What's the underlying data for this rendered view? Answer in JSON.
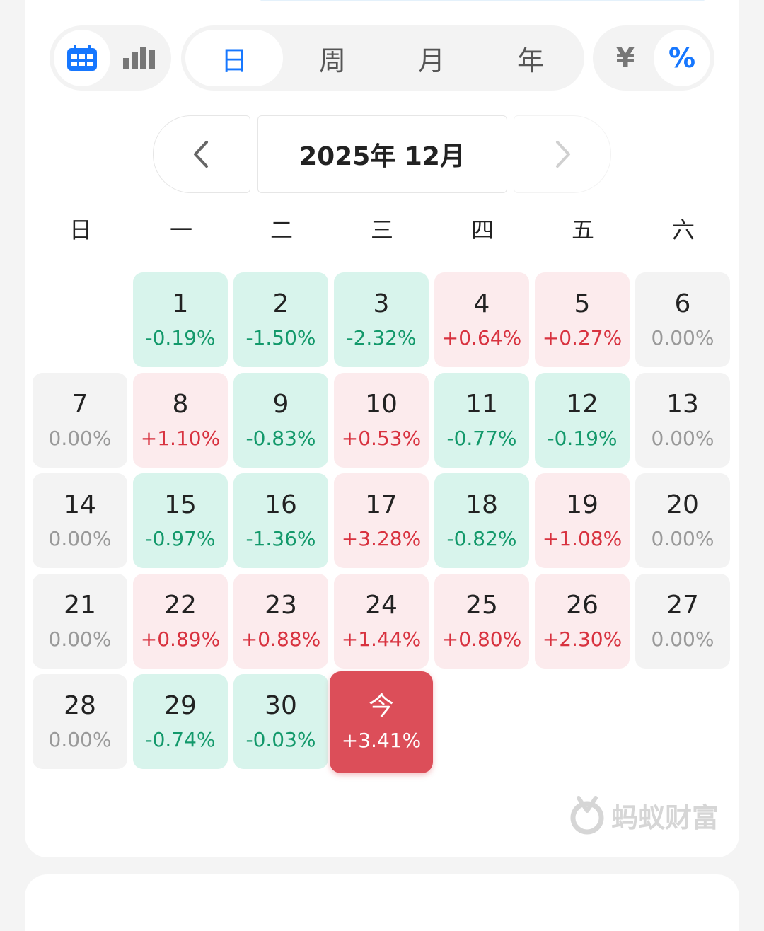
{
  "toolbar": {
    "view_icons": [
      "calendar-icon",
      "bar-chart-icon"
    ],
    "periods": [
      "日",
      "周",
      "月",
      "年"
    ],
    "active_period": "日",
    "units": [
      "¥",
      "%"
    ],
    "active_unit": "%",
    "accent_color": "#1677ff"
  },
  "month_nav": {
    "prev_icon": "chevron-left-icon",
    "title": "2025年 12月",
    "next_icon": "chevron-right-icon"
  },
  "weekdays": [
    "日",
    "一",
    "二",
    "三",
    "四",
    "五",
    "六"
  ],
  "calendar": {
    "colors": {
      "up": "#d8323f",
      "down": "#13996b",
      "today_bg": "#dc4e59"
    },
    "days": [
      {
        "day": "1",
        "pct": "-0.19%",
        "kind": "down",
        "col": 1,
        "row": 0
      },
      {
        "day": "2",
        "pct": "-1.50%",
        "kind": "down",
        "col": 2,
        "row": 0
      },
      {
        "day": "3",
        "pct": "-2.32%",
        "kind": "down",
        "col": 3,
        "row": 0
      },
      {
        "day": "4",
        "pct": "+0.64%",
        "kind": "up",
        "col": 4,
        "row": 0
      },
      {
        "day": "5",
        "pct": "+0.27%",
        "kind": "up",
        "col": 5,
        "row": 0
      },
      {
        "day": "6",
        "pct": "0.00%",
        "kind": "neutral",
        "col": 6,
        "row": 0
      },
      {
        "day": "7",
        "pct": "0.00%",
        "kind": "neutral",
        "col": 0,
        "row": 1
      },
      {
        "day": "8",
        "pct": "+1.10%",
        "kind": "up",
        "col": 1,
        "row": 1
      },
      {
        "day": "9",
        "pct": "-0.83%",
        "kind": "down",
        "col": 2,
        "row": 1
      },
      {
        "day": "10",
        "pct": "+0.53%",
        "kind": "up",
        "col": 3,
        "row": 1
      },
      {
        "day": "11",
        "pct": "-0.77%",
        "kind": "down",
        "col": 4,
        "row": 1
      },
      {
        "day": "12",
        "pct": "-0.19%",
        "kind": "down",
        "col": 5,
        "row": 1
      },
      {
        "day": "13",
        "pct": "0.00%",
        "kind": "neutral",
        "col": 6,
        "row": 1
      },
      {
        "day": "14",
        "pct": "0.00%",
        "kind": "neutral",
        "col": 0,
        "row": 2
      },
      {
        "day": "15",
        "pct": "-0.97%",
        "kind": "down",
        "col": 1,
        "row": 2
      },
      {
        "day": "16",
        "pct": "-1.36%",
        "kind": "down",
        "col": 2,
        "row": 2
      },
      {
        "day": "17",
        "pct": "+3.28%",
        "kind": "up",
        "col": 3,
        "row": 2
      },
      {
        "day": "18",
        "pct": "-0.82%",
        "kind": "down",
        "col": 4,
        "row": 2
      },
      {
        "day": "19",
        "pct": "+1.08%",
        "kind": "up",
        "col": 5,
        "row": 2
      },
      {
        "day": "20",
        "pct": "0.00%",
        "kind": "neutral",
        "col": 6,
        "row": 2
      },
      {
        "day": "21",
        "pct": "0.00%",
        "kind": "neutral",
        "col": 0,
        "row": 3
      },
      {
        "day": "22",
        "pct": "+0.89%",
        "kind": "up",
        "col": 1,
        "row": 3
      },
      {
        "day": "23",
        "pct": "+0.88%",
        "kind": "up",
        "col": 2,
        "row": 3
      },
      {
        "day": "24",
        "pct": "+1.44%",
        "kind": "up",
        "col": 3,
        "row": 3
      },
      {
        "day": "25",
        "pct": "+0.80%",
        "kind": "up",
        "col": 4,
        "row": 3
      },
      {
        "day": "26",
        "pct": "+2.30%",
        "kind": "up",
        "col": 5,
        "row": 3
      },
      {
        "day": "27",
        "pct": "0.00%",
        "kind": "neutral",
        "col": 6,
        "row": 3
      },
      {
        "day": "28",
        "pct": "0.00%",
        "kind": "neutral",
        "col": 0,
        "row": 4
      },
      {
        "day": "29",
        "pct": "-0.74%",
        "kind": "down",
        "col": 1,
        "row": 4
      },
      {
        "day": "30",
        "pct": "-0.03%",
        "kind": "down",
        "col": 2,
        "row": 4
      },
      {
        "day": "今",
        "pct": "+3.41%",
        "kind": "today",
        "col": 3,
        "row": 4
      }
    ]
  },
  "watermark": {
    "icon": "ant-fortune-logo-icon",
    "text": "蚂蚁财富"
  }
}
